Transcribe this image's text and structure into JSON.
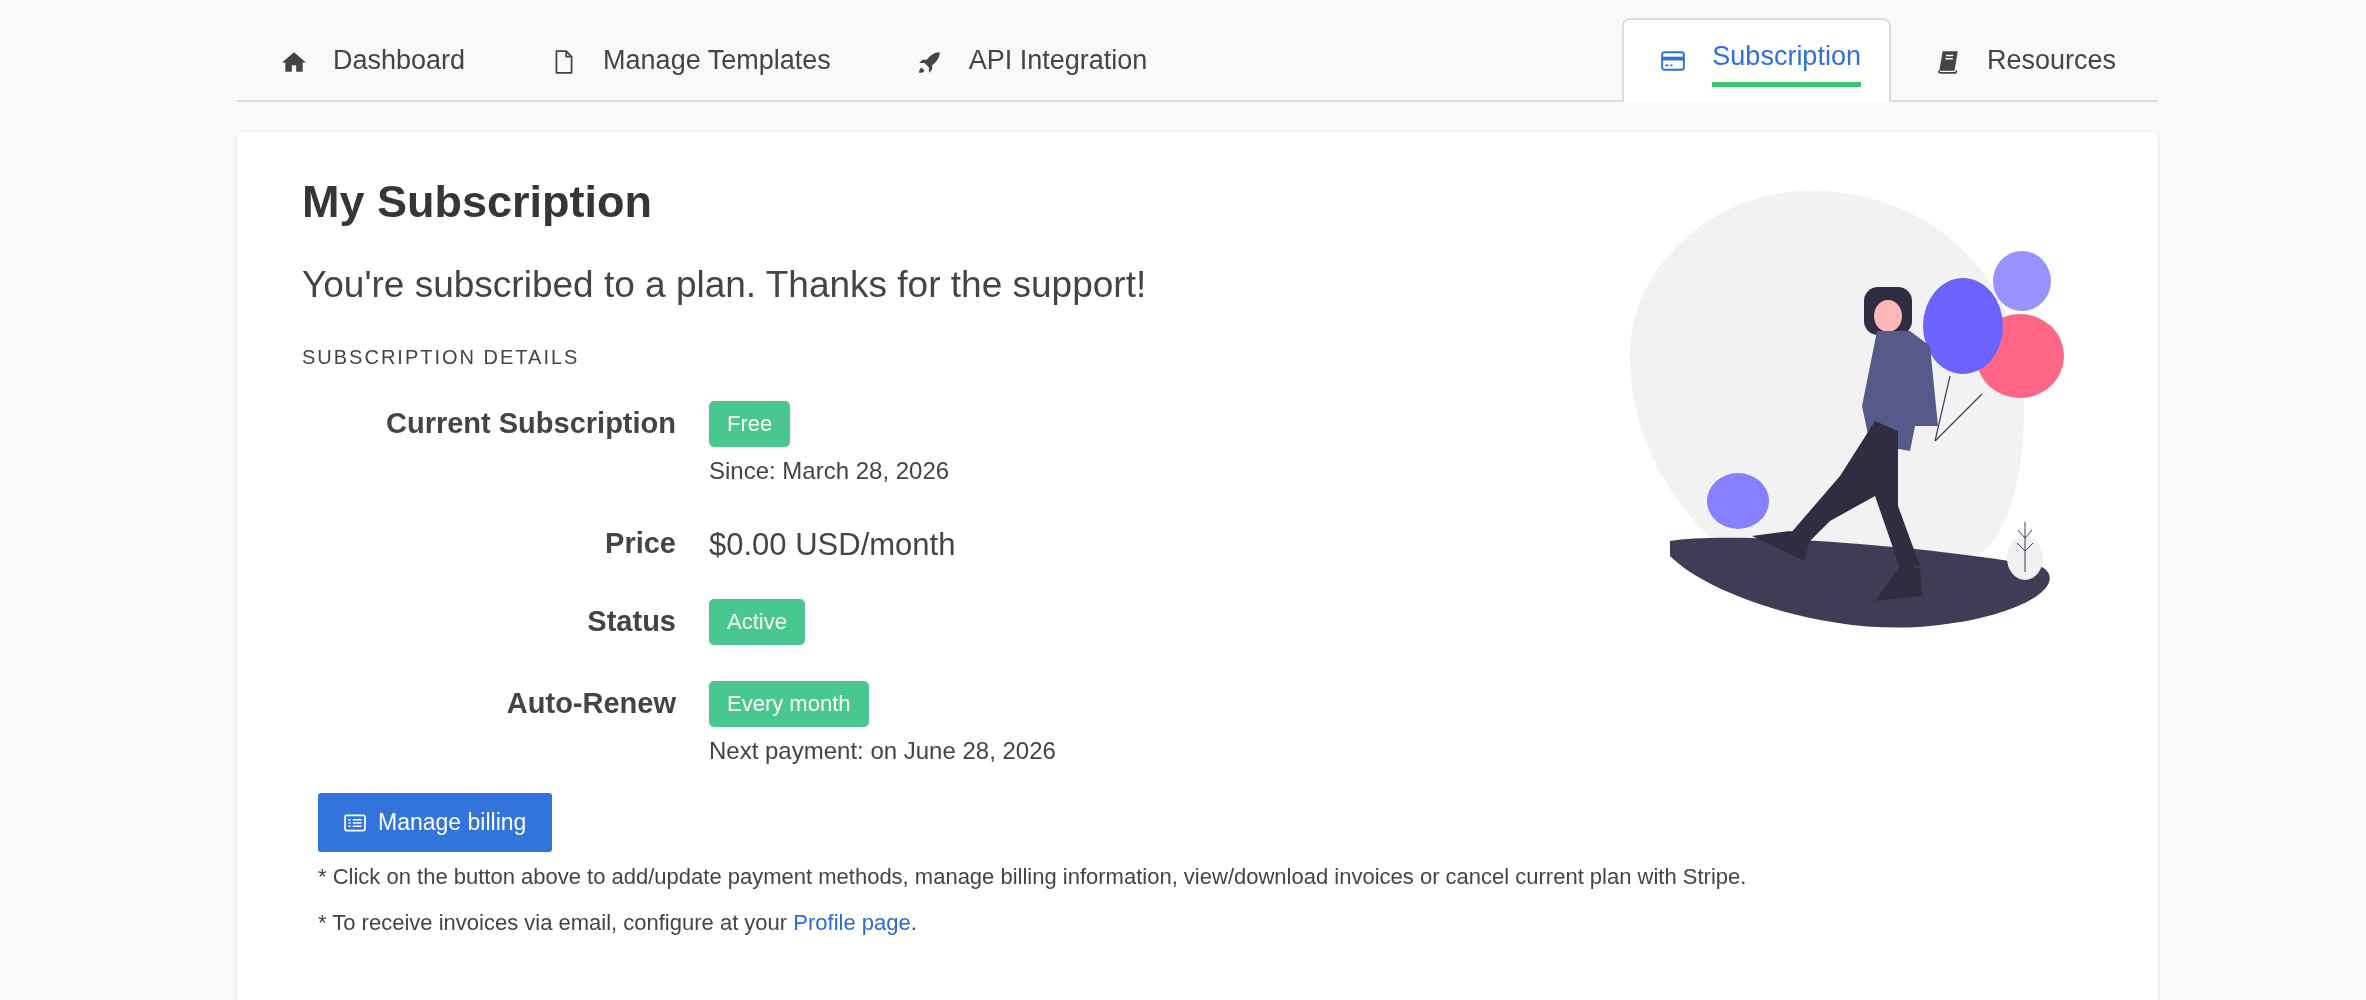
{
  "tabs": [
    {
      "label": "Dashboard",
      "kind": "home",
      "selected": false
    },
    {
      "label": "Manage Templates",
      "kind": "file",
      "selected": false
    },
    {
      "label": "API Integration",
      "kind": "rocket",
      "selected": false
    },
    {
      "label": "Subscription",
      "kind": "card",
      "selected": true
    },
    {
      "label": "Resources",
      "kind": "book",
      "selected": false
    }
  ],
  "title": "My Subscription",
  "subtitle": "You're subscribed to a plan. Thanks for the support!",
  "section_heading": "SUBSCRIPTION DETAILS",
  "details": [
    {
      "label": "Current Subscription",
      "kind": "badge",
      "value": "Free",
      "note": "Since: March 28, 2026"
    },
    {
      "label": "Price",
      "kind": "text",
      "value": "$0.00 USD/month"
    },
    {
      "label": "Status",
      "kind": "badge",
      "value": "Active"
    },
    {
      "label": "Auto-Renew",
      "kind": "badge",
      "value": "Every month",
      "note": "Next payment: on June 28, 2026"
    }
  ],
  "button": "Manage billing",
  "notes": [
    {
      "text": "* Click on the button above to add/update payment methods, manage billing information, view/download invoices or cancel current plan with Stripe."
    },
    {
      "text": "* To receive invoices via email, configure at your ",
      "link": "Profile page",
      "after": "."
    }
  ]
}
